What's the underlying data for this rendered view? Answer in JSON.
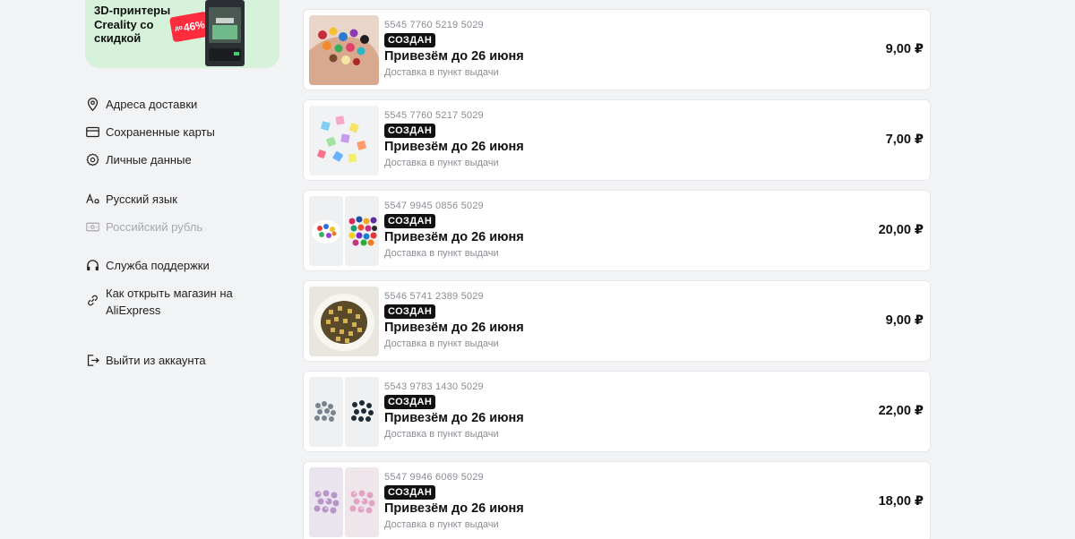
{
  "promo": {
    "text": "3D-принтеры Creality со скидкой",
    "badge_prefix": "до",
    "badge_value": "46%"
  },
  "sidebar": {
    "items": [
      {
        "label": "Адреса доставки",
        "icon": "location-pin-icon"
      },
      {
        "label": "Сохраненные карты",
        "icon": "credit-card-icon"
      },
      {
        "label": "Личные данные",
        "icon": "gear-icon"
      },
      {
        "label": "Русский язык",
        "icon": "language-icon"
      },
      {
        "label": "Российский рубль",
        "icon": "currency-icon",
        "disabled": true
      },
      {
        "label": "Служба поддержки",
        "icon": "headphones-icon"
      },
      {
        "label": "Как открыть магазин на AliExpress",
        "icon": "link-icon"
      },
      {
        "label": "Выйти из аккаунта",
        "icon": "logout-icon"
      }
    ]
  },
  "orders": [
    {
      "number": "5545 7760 5219 5029",
      "status": "СОЗДАН",
      "title": "Привезём до 26 июня",
      "subtitle": "Доставка в пункт выдачи",
      "price": "9,00 ₽",
      "thumbs": [
        "colorful-beads-in-hand"
      ]
    },
    {
      "number": "5545 7760 5217 5029",
      "status": "СОЗДАН",
      "title": "Привезём до 26 июня",
      "subtitle": "Доставка в пункт выдачи",
      "price": "7,00 ₽",
      "thumbs": [
        "glass-cube-beads"
      ]
    },
    {
      "number": "5547 9945 0856 5029",
      "status": "СОЗДАН",
      "title": "Привезём до 26 июня",
      "subtitle": "Доставка в пункт выдачи",
      "price": "20,00 ₽",
      "thumbs": [
        "bead-bowl",
        "multicolor-beads"
      ]
    },
    {
      "number": "5546 5741 2389 5029",
      "status": "СОЗДАН",
      "title": "Привезём до 26 июня",
      "subtitle": "Доставка в пункт выдачи",
      "price": "9,00 ₽",
      "thumbs": [
        "gold-letter-beads-bowl"
      ]
    },
    {
      "number": "5543 9783 1430 5029",
      "status": "СОЗДАН",
      "title": "Привезём до 26 июня",
      "subtitle": "Доставка в пункт выдачи",
      "price": "22,00 ₽",
      "thumbs": [
        "grey-beads",
        "black-beads"
      ]
    },
    {
      "number": "5547 9946 6069 5029",
      "status": "СОЗДАН",
      "title": "Привезём до 26 июня",
      "subtitle": "Доставка в пункт выдачи",
      "price": "18,00 ₽",
      "thumbs": [
        "lilac-pearl-beads",
        "pink-pearl-beads"
      ]
    }
  ]
}
